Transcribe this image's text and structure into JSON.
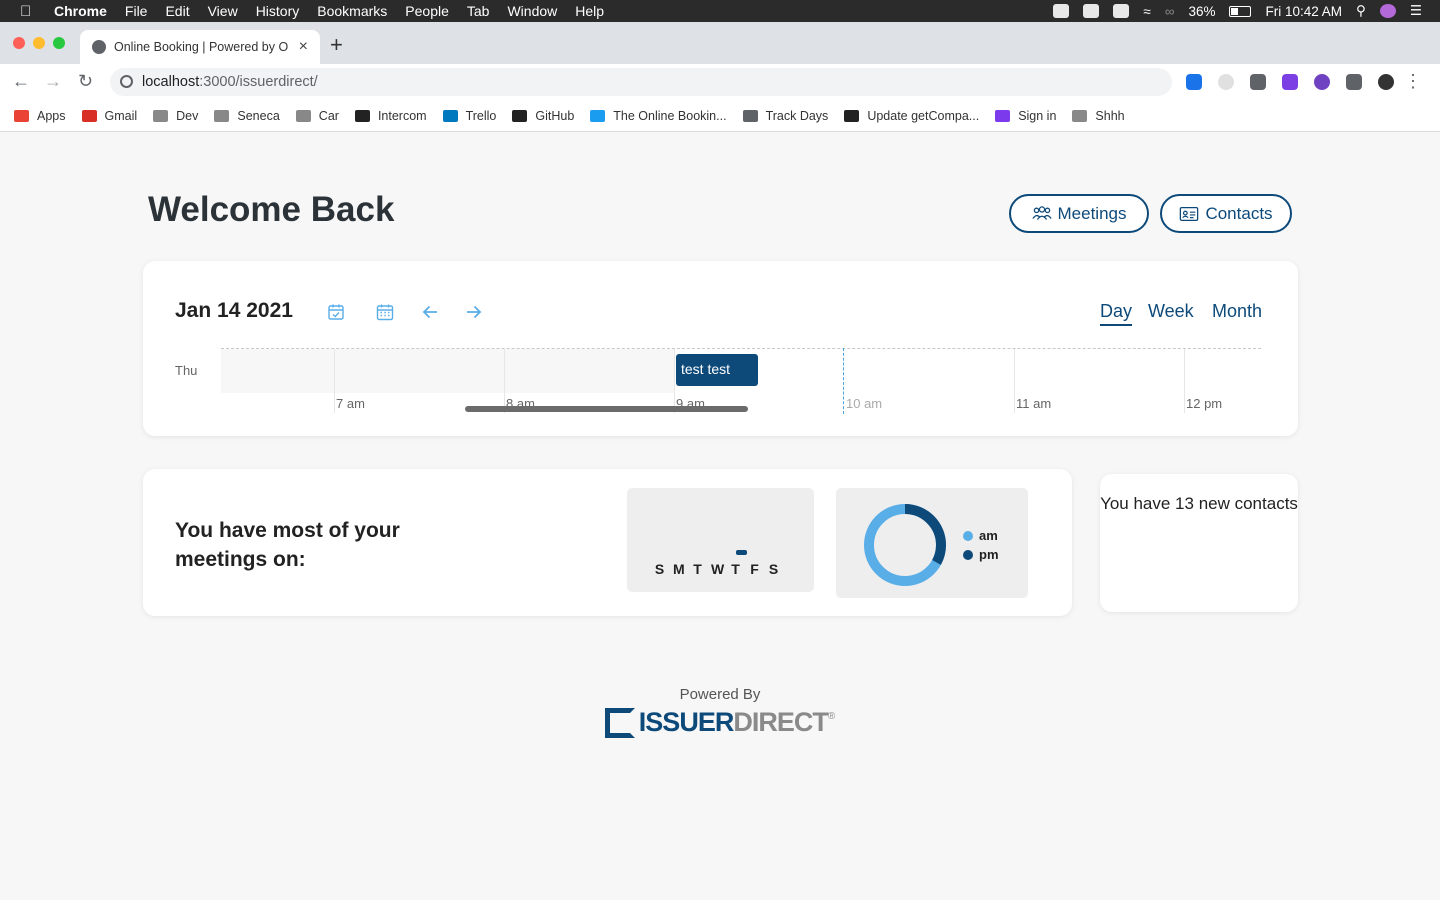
{
  "menubar": {
    "app": "Chrome",
    "items": [
      "File",
      "Edit",
      "View",
      "History",
      "Bookmarks",
      "People",
      "Tab",
      "Window",
      "Help"
    ],
    "battery": "36%",
    "clock": "Fri 10:42 AM"
  },
  "browser": {
    "tab_title": "Online Booking | Powered by O",
    "url_host": "localhost",
    "url_rest": ":3000/issuerdirect/",
    "bookmarks": [
      {
        "label": "Apps",
        "icon": "apps-grid-icon",
        "color": "#ea4335"
      },
      {
        "label": "Gmail",
        "icon": "gmail-icon",
        "color": "#d93025"
      },
      {
        "label": "Dev",
        "icon": "folder-icon",
        "color": "#888888"
      },
      {
        "label": "Seneca",
        "icon": "folder-icon",
        "color": "#888888"
      },
      {
        "label": "Car",
        "icon": "folder-icon",
        "color": "#888888"
      },
      {
        "label": "Intercom",
        "icon": "intercom-icon",
        "color": "#222222"
      },
      {
        "label": "Trello",
        "icon": "trello-icon",
        "color": "#0079bf"
      },
      {
        "label": "GitHub",
        "icon": "github-icon",
        "color": "#222222"
      },
      {
        "label": "The Online Bookin...",
        "icon": "booking-icon",
        "color": "#1a9cf0"
      },
      {
        "label": "Track Days",
        "icon": "globe-icon",
        "color": "#5f6368"
      },
      {
        "label": "Update getCompa...",
        "icon": "github-icon",
        "color": "#222222"
      },
      {
        "label": "Sign in",
        "icon": "signin-icon",
        "color": "#7c3aed"
      },
      {
        "label": "Shhh",
        "icon": "folder-icon",
        "color": "#888888"
      }
    ]
  },
  "header": {
    "title": "Welcome Back",
    "meetings_label": "Meetings",
    "contacts_label": "Contacts"
  },
  "calendar": {
    "date": "Jan 14 2021",
    "views": [
      "Day",
      "Week",
      "Month"
    ],
    "active_view": "Day",
    "day_label": "Thu",
    "time_labels": [
      "7 am",
      "8 am",
      "9 am",
      "10 am",
      "11 am",
      "12 pm"
    ],
    "event_title": "test test"
  },
  "stats": {
    "heading": "You have most of your meetings on:",
    "weekdays": [
      "S",
      "M",
      "T",
      "W",
      "T",
      "F",
      "S"
    ],
    "busiest_day": "T",
    "legend": [
      "am",
      "pm"
    ],
    "am_share": 0.67,
    "pm_share": 0.33,
    "am_color": "#5aaee8",
    "pm_color": "#0d4a7a"
  },
  "contacts_card": {
    "message": "You have 13 new contacts"
  },
  "footer": {
    "powered_by": "Powered By",
    "logo_issuer": "ISSUER",
    "logo_direct": "DIRECT",
    "logo_mark": "®"
  }
}
